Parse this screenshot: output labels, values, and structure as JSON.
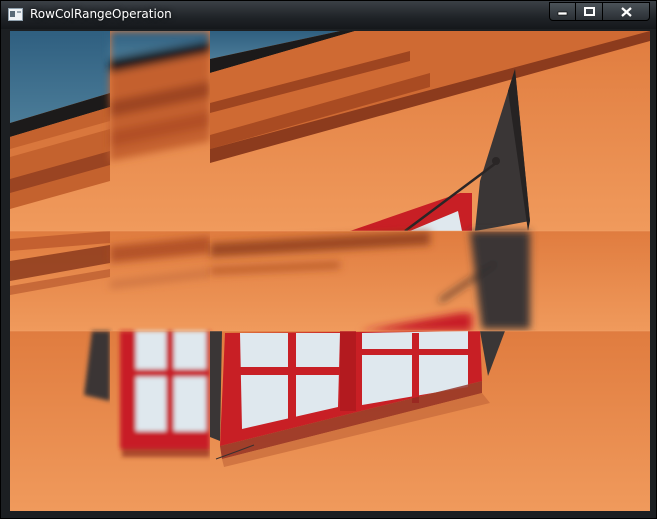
{
  "window": {
    "title": "RowColRangeOperation",
    "controls": {
      "minimize_icon": "minimize-icon",
      "maximize_icon": "maximize-icon",
      "close_icon": "close-icon"
    }
  },
  "image": {
    "subject": "orange building wall with red-framed window, displayed as a 3x3 grid of shifted and blurred tiles",
    "colors": {
      "sky": "#3f6f8e",
      "wall": "#e88d4e",
      "wall_shadow": "#b8582d",
      "window_frame": "#c81f25",
      "window_glass": "#dfe8ee",
      "shutter": "#3a3636"
    }
  }
}
